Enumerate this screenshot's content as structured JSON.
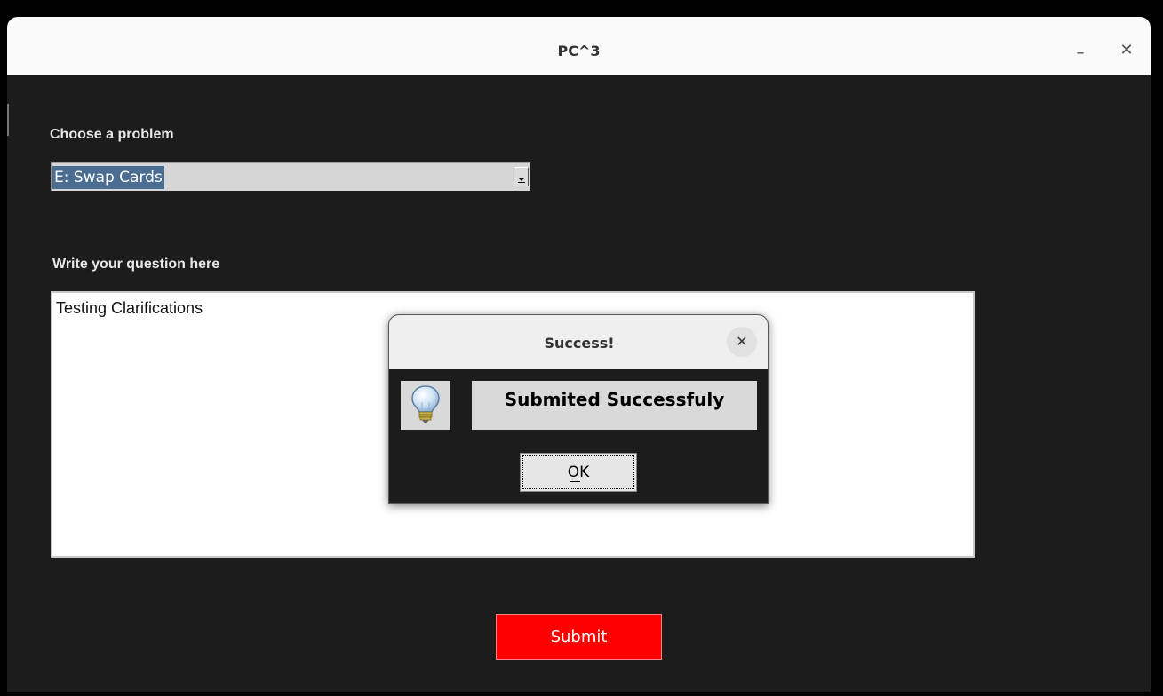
{
  "window": {
    "title": "PC^3",
    "minimize_glyph": "–",
    "close_glyph": "✕"
  },
  "form": {
    "problem_label": "Choose a problem",
    "problem_selected": "E: Swap Cards",
    "question_label": "Write your question here",
    "question_text": "Testing Clarifications",
    "submit_label": "Submit"
  },
  "dialog": {
    "title": "Success!",
    "close_glyph": "✕",
    "icon": "lightbulb-icon",
    "message": "Submited Successfuly",
    "ok_label": "OK"
  },
  "colors": {
    "background": "#1c1c1c",
    "submit": "#ff0000",
    "selection": "#4a6d91"
  }
}
